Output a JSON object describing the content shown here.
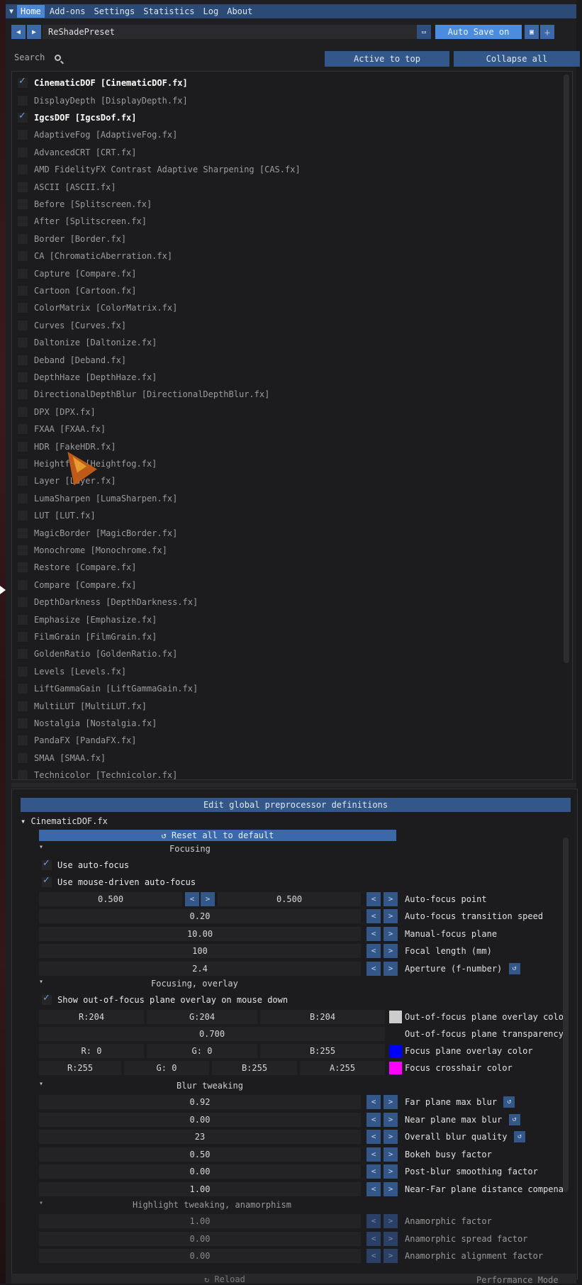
{
  "menu": [
    "Home",
    "Add-ons",
    "Settings",
    "Statistics",
    "Log",
    "About"
  ],
  "preset": {
    "name": "ReShadePreset",
    "autosave": "Auto Save on"
  },
  "search": {
    "label": "Search",
    "active_to_top": "Active to top",
    "collapse_all": "Collapse all"
  },
  "effects": [
    {
      "label": "CinematicDOF [CinematicDOF.fx]",
      "on": true
    },
    {
      "label": "DisplayDepth [DisplayDepth.fx]",
      "on": false
    },
    {
      "label": "IgcsDOF [IgcsDof.fx]",
      "on": true
    },
    {
      "label": "AdaptiveFog [AdaptiveFog.fx]",
      "on": false
    },
    {
      "label": "AdvancedCRT [CRT.fx]",
      "on": false
    },
    {
      "label": "AMD FidelityFX Contrast Adaptive Sharpening [CAS.fx]",
      "on": false
    },
    {
      "label": "ASCII [ASCII.fx]",
      "on": false
    },
    {
      "label": "Before [Splitscreen.fx]",
      "on": false
    },
    {
      "label": "After [Splitscreen.fx]",
      "on": false
    },
    {
      "label": "Border [Border.fx]",
      "on": false
    },
    {
      "label": "CA [ChromaticAberration.fx]",
      "on": false
    },
    {
      "label": "Capture [Compare.fx]",
      "on": false
    },
    {
      "label": "Cartoon [Cartoon.fx]",
      "on": false
    },
    {
      "label": "ColorMatrix [ColorMatrix.fx]",
      "on": false
    },
    {
      "label": "Curves [Curves.fx]",
      "on": false
    },
    {
      "label": "Daltonize [Daltonize.fx]",
      "on": false
    },
    {
      "label": "Deband [Deband.fx]",
      "on": false
    },
    {
      "label": "DepthHaze [DepthHaze.fx]",
      "on": false
    },
    {
      "label": "DirectionalDepthBlur [DirectionalDepthBlur.fx]",
      "on": false
    },
    {
      "label": "DPX [DPX.fx]",
      "on": false
    },
    {
      "label": "FXAA [FXAA.fx]",
      "on": false
    },
    {
      "label": "HDR [FakeHDR.fx]",
      "on": false
    },
    {
      "label": "Heightfog [Heightfog.fx]",
      "on": false
    },
    {
      "label": "Layer [Layer.fx]",
      "on": false
    },
    {
      "label": "LumaSharpen [LumaSharpen.fx]",
      "on": false
    },
    {
      "label": "LUT [LUT.fx]",
      "on": false
    },
    {
      "label": "MagicBorder [MagicBorder.fx]",
      "on": false
    },
    {
      "label": "Monochrome [Monochrome.fx]",
      "on": false
    },
    {
      "label": "Restore [Compare.fx]",
      "on": false
    },
    {
      "label": "Compare [Compare.fx]",
      "on": false
    },
    {
      "label": "DepthDarkness [DepthDarkness.fx]",
      "on": false
    },
    {
      "label": "Emphasize [Emphasize.fx]",
      "on": false
    },
    {
      "label": "FilmGrain [FilmGrain.fx]",
      "on": false
    },
    {
      "label": "GoldenRatio [GoldenRatio.fx]",
      "on": false
    },
    {
      "label": "Levels [Levels.fx]",
      "on": false
    },
    {
      "label": "LiftGammaGain [LiftGammaGain.fx]",
      "on": false
    },
    {
      "label": "MultiLUT [MultiLUT.fx]",
      "on": false
    },
    {
      "label": "Nostalgia [Nostalgia.fx]",
      "on": false
    },
    {
      "label": "PandaFX [PandaFX.fx]",
      "on": false
    },
    {
      "label": "SMAA [SMAA.fx]",
      "on": false
    },
    {
      "label": "Technicolor [Technicolor.fx]",
      "on": false
    }
  ],
  "bottom": {
    "global_defs": "Edit global preprocessor definitions",
    "effect_name": "CinematicDOF.fx",
    "reset_all": "Reset all to default",
    "sections": {
      "focusing": "Focusing",
      "focusing_overlay": "Focusing, overlay",
      "blur_tweaking": "Blur tweaking",
      "highlight": "Highlight tweaking, anamorphism"
    },
    "checks": {
      "auto_focus": "Use auto-focus",
      "mouse_focus": "Use mouse-driven auto-focus",
      "show_overlay": "Show out-of-focus plane overlay on mouse down"
    },
    "autofocus_point": {
      "x": "0.500",
      "y": "0.500",
      "label": "Auto-focus point"
    },
    "params_focus": [
      {
        "value": "0.20",
        "label": "Auto-focus transition speed"
      },
      {
        "value": "10.00",
        "label": "Manual-focus plane"
      },
      {
        "value": "100",
        "label": "Focal length (mm)"
      },
      {
        "value": "2.4",
        "label": "Aperture (f-number)"
      }
    ],
    "overlay_color": {
      "r": "R:204",
      "g": "G:204",
      "b": "B:204",
      "label": "Out-of-focus plane overlay colo",
      "swatch": "#cccccc"
    },
    "overlay_transparency": {
      "value": "0.700",
      "label": "Out-of-focus plane transparency"
    },
    "focus_plane_color": {
      "r": "R:  0",
      "g": "G:  0",
      "b": "B:255",
      "label": "Focus plane overlay color",
      "swatch": "#0000ff"
    },
    "crosshair_color": {
      "r": "R:255",
      "g": "G:  0",
      "b": "B:255",
      "a": "A:255",
      "label": "Focus crosshair color",
      "swatch": "#ff00ff"
    },
    "params_blur": [
      {
        "value": "0.92",
        "label": "Far plane max blur"
      },
      {
        "value": "0.00",
        "label": "Near plane max blur"
      },
      {
        "value": "23",
        "label": "Overall blur quality"
      },
      {
        "value": "0.50",
        "label": "Bokeh busy factor"
      },
      {
        "value": "0.00",
        "label": "Post-blur smoothing factor"
      },
      {
        "value": "1.00",
        "label": "Near-Far plane distance compena"
      }
    ],
    "params_highlight": [
      {
        "value": "1.00",
        "label": "Anamorphic factor"
      },
      {
        "value": "0.00",
        "label": "Anamorphic spread factor"
      },
      {
        "value": "0.00",
        "label": "Anamorphic alignment factor"
      }
    ],
    "reload": "Reload",
    "performance_mode": "Performance Mode"
  }
}
